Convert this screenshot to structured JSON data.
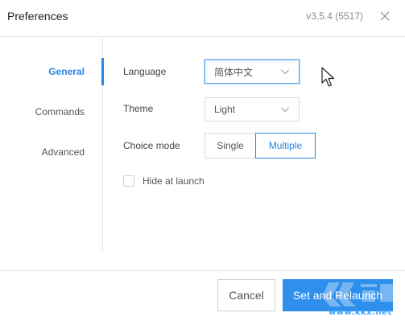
{
  "window": {
    "title": "Preferences",
    "version": "v3.5.4 (5517)"
  },
  "sidebar": {
    "items": [
      {
        "label": "General",
        "active": true
      },
      {
        "label": "Commands",
        "active": false
      },
      {
        "label": "Advanced",
        "active": false
      }
    ]
  },
  "general": {
    "language_label": "Language",
    "language_value": "简体中文",
    "theme_label": "Theme",
    "theme_value": "Light",
    "choice_mode_label": "Choice mode",
    "choice_mode_options": [
      "Single",
      "Multiple"
    ],
    "choice_mode_selected": "Multiple",
    "hide_at_launch_label": "Hide at launch",
    "hide_at_launch_checked": false
  },
  "footer": {
    "cancel_label": "Cancel",
    "primary_label": "Set and Relaunch"
  },
  "overlay": {
    "watermark_text": "www.kkx.net"
  },
  "colors": {
    "accent": "#2a86e0",
    "primary_button": "#2f8fec",
    "border": "#d9d9d9"
  },
  "icons": {
    "close": "close-icon",
    "dropdown": "chevron-down-icon",
    "cursor": "mouse-pointer-icon"
  }
}
